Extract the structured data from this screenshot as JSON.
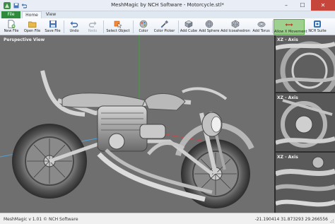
{
  "window": {
    "title": "MeshMagic by NCH Software - Motorcycle.stl*",
    "minimize_glyph": "–",
    "maximize_glyph": "☐",
    "close_glyph": "✕"
  },
  "tabs": [
    {
      "label": "File"
    },
    {
      "label": "Home"
    },
    {
      "label": "View"
    }
  ],
  "toolbar": [
    {
      "label": "New File",
      "icon": "new-file-icon"
    },
    {
      "label": "Open File",
      "icon": "open-file-icon"
    },
    {
      "label": "Save File",
      "icon": "save-file-icon"
    },
    {
      "label": "Undo",
      "icon": "undo-icon"
    },
    {
      "label": "Redo",
      "icon": "redo-icon",
      "disabled": true
    },
    {
      "label": "Select Object",
      "icon": "select-object-icon"
    },
    {
      "label": "Color",
      "icon": "color-icon"
    },
    {
      "label": "Color Picker",
      "icon": "color-picker-icon"
    },
    {
      "label": "Add Cube",
      "icon": "add-cube-icon"
    },
    {
      "label": "Add Sphere",
      "icon": "add-sphere-icon"
    },
    {
      "label": "Add Icosahedron",
      "icon": "add-icosahedron-icon"
    },
    {
      "label": "Add Torus",
      "icon": "add-torus-icon"
    },
    {
      "label": "Allow X Movement",
      "icon": "allow-x-movement-icon",
      "selected": true
    },
    {
      "label": "NCH Suite",
      "icon": "nch-suite-icon"
    }
  ],
  "views": {
    "main": "Perspective View",
    "side": [
      "XZ - Axis",
      "XZ - Axis",
      "XZ - Axis"
    ]
  },
  "status": {
    "version": "MeshMagic v 1.01 © NCH Software",
    "coordinates": "-21.190414 31.873293 29.266556"
  },
  "colors": {
    "file_tab": "#2e8b3e",
    "selected_tool": "#9ed08f",
    "viewport_bg": "#6f6f70",
    "close_button": "#c7463c"
  }
}
